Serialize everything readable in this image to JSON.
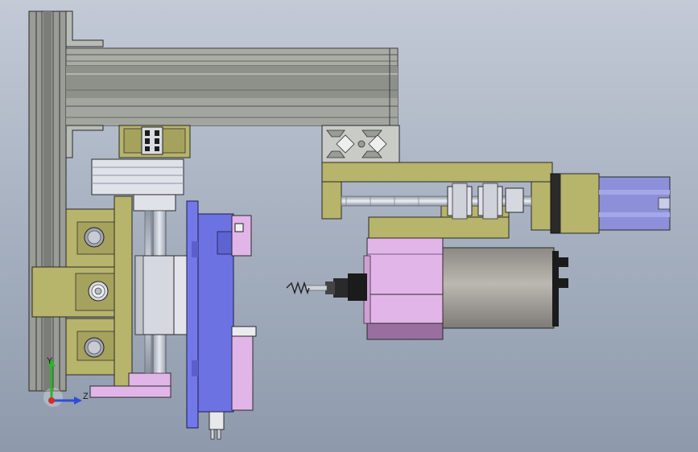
{
  "viewport": {
    "background_top": "#c3cad6",
    "background_bottom": "#8e99ab"
  },
  "colors": {
    "frame": "#9a9c96",
    "frame_dark": "#6e716c",
    "olive": "#b7b46b",
    "pink": "#e2b5e8",
    "motor_grey": "#a9a6a0",
    "blue_plate": "#7378e8",
    "steel": "#cfd2d8",
    "black": "#1b1b1b"
  },
  "triad": {
    "y_axis_label": "Y",
    "z_axis_label": "Z",
    "y_axis_color": "#2bb52b",
    "z_axis_color": "#2b4fd6",
    "x_axis_color": "#d62b2b"
  },
  "parts": [
    "vertical-extrusion-post",
    "horizontal-extrusion-beam",
    "extrusion-profile-end",
    "shaft-coupling",
    "linear-guide-block",
    "lead-screw",
    "stepper-motor",
    "spindle-motor",
    "drill-bit",
    "mounting-plate",
    "roller-wheel"
  ]
}
